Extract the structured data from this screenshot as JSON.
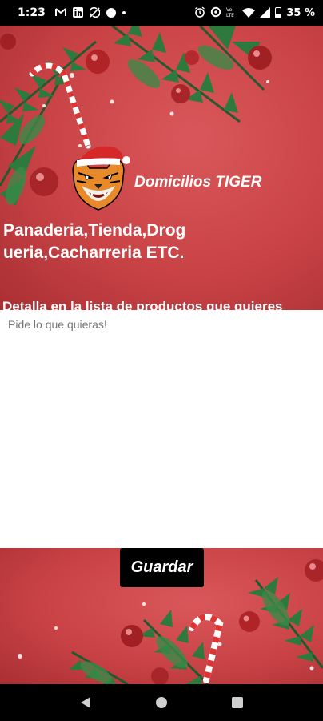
{
  "status_bar": {
    "time": "1:23",
    "battery_percent": "35 %",
    "left_icons": [
      "gmail-icon",
      "linkedin-icon",
      "sync-off-icon",
      "circle-icon",
      "dot-icon"
    ],
    "right_icons": [
      "alarm-icon",
      "data-saver-icon",
      "volte-icon",
      "wifi-icon",
      "signal-icon",
      "battery-icon"
    ]
  },
  "header": {
    "app_title": "Domicilios TIGER",
    "logo": "tiger-santa-hat-logo"
  },
  "main": {
    "categories_text": "Panaderia,Tienda,Drogueria,Cacharreria ETC.",
    "instruction_text": "Detalla en la lista de productos que quieres comprar",
    "order_input": {
      "placeholder": "Pide lo que quieras!",
      "value": ""
    },
    "save_label": "Guardar"
  },
  "nav_bar": {
    "buttons": [
      "back-icon",
      "home-icon",
      "recents-icon"
    ]
  },
  "colors": {
    "background_red": "#c94346",
    "accent_black": "#000000",
    "text_white": "#ffffff"
  }
}
